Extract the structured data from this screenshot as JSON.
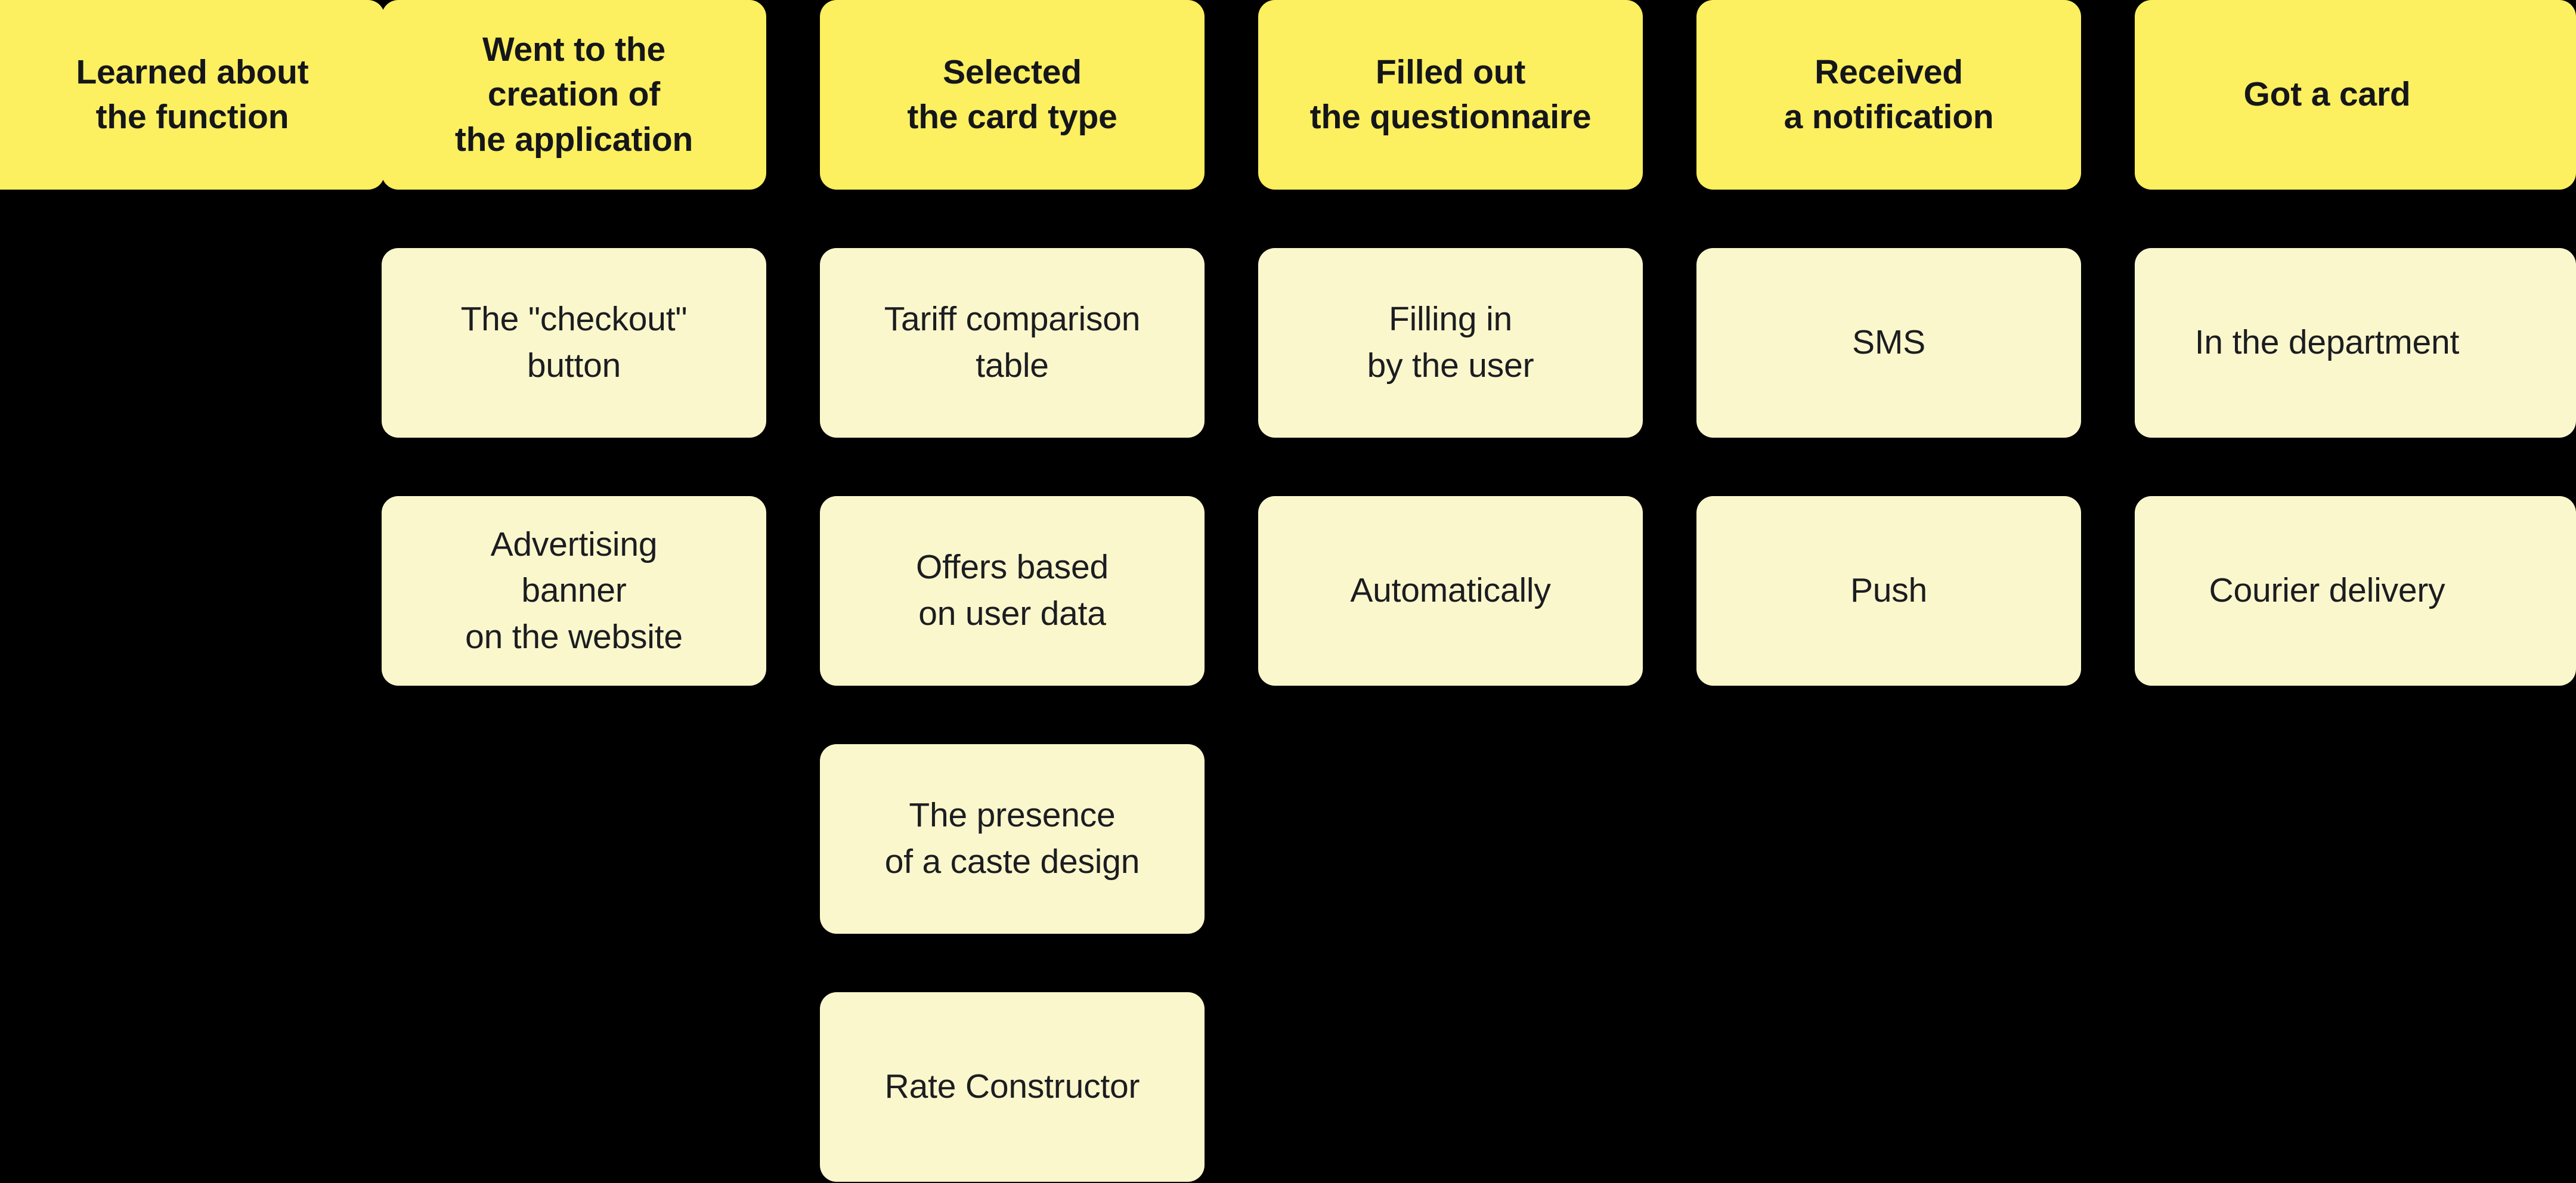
{
  "board": {
    "background_color": "#000000",
    "stage_card_color": "#FCEF60",
    "option_card_color": "#FBF7CC",
    "text_color": "#15161A"
  },
  "columns": [
    {
      "stage": "Learned about\nthe function",
      "options": []
    },
    {
      "stage": "Went to the\ncreation of\nthe application",
      "options": [
        "The \"checkout\"\nbutton",
        "Advertising\nbanner\non the website"
      ]
    },
    {
      "stage": "Selected\nthe card type",
      "options": [
        "Tariff comparison\ntable",
        "Offers based\non user data",
        "The presence\nof a caste design",
        "Rate Constructor"
      ]
    },
    {
      "stage": "Filled out\nthe questionnaire",
      "options": [
        "Filling in\nby the user",
        "Automatically"
      ]
    },
    {
      "stage": "Received\na notification",
      "options": [
        "SMS",
        "Push"
      ]
    },
    {
      "stage": "Got a card",
      "options": [
        "In the department",
        "Courier delivery"
      ]
    }
  ]
}
